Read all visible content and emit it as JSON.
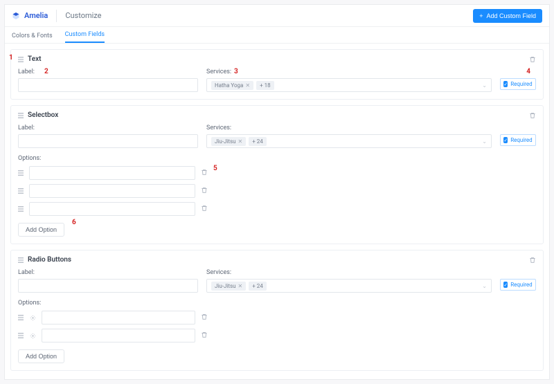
{
  "header": {
    "brand": "Amelia",
    "page_title": "Customize",
    "add_button": "Add Custom Field",
    "add_button_plus": "+"
  },
  "tabs": {
    "colors_fonts": "Colors & Fonts",
    "custom_fields": "Custom Fields"
  },
  "labels": {
    "label": "Label:",
    "services": "Services:",
    "options": "Options:",
    "required": "Required",
    "add_option": "Add Option"
  },
  "annotations": {
    "a1": "1",
    "a2": "2",
    "a3": "3",
    "a4": "4",
    "a5": "5",
    "a6": "6"
  },
  "fields": [
    {
      "type": "Text",
      "label_value": "",
      "service_tags": [
        {
          "text": "Hatha Yoga",
          "removable": true
        },
        {
          "text": "+ 18",
          "removable": false
        }
      ],
      "required": true
    },
    {
      "type": "Selectbox",
      "label_value": "",
      "service_tags": [
        {
          "text": "Jiu-Jitsu",
          "removable": true
        },
        {
          "text": "+ 24",
          "removable": false
        }
      ],
      "required": true,
      "options": [
        "",
        "",
        ""
      ]
    },
    {
      "type": "Radio Buttons",
      "label_value": "",
      "service_tags": [
        {
          "text": "Jiu-Jitsu",
          "removable": true
        },
        {
          "text": "+ 24",
          "removable": false
        }
      ],
      "required": true,
      "radio_options": [
        "",
        ""
      ]
    }
  ]
}
